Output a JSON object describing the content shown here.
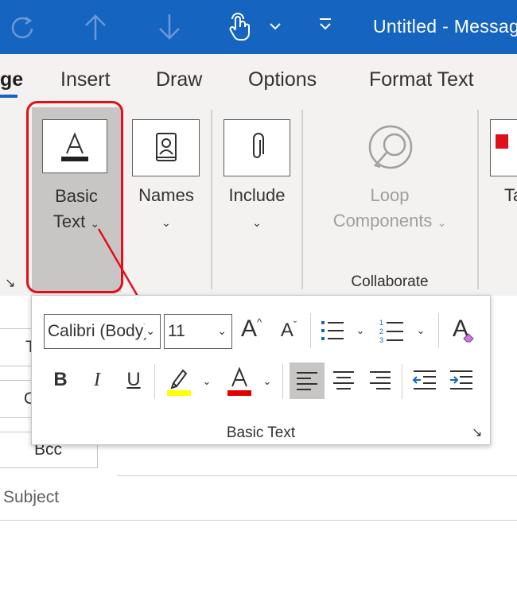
{
  "window": {
    "title": "Untitled  -  Message"
  },
  "quick_access": [
    {
      "name": "redo-icon"
    },
    {
      "name": "up-arrow-icon"
    },
    {
      "name": "down-arrow-icon"
    },
    {
      "name": "touch-mode-icon"
    },
    {
      "name": "customize-toolbar-icon"
    }
  ],
  "tabs": [
    {
      "label": "Message",
      "visible": "ge",
      "selected": true
    },
    {
      "label": "Insert"
    },
    {
      "label": "Draw"
    },
    {
      "label": "Options"
    },
    {
      "label": "Format Text"
    }
  ],
  "ribbon": {
    "basic_text": {
      "line1": "Basic",
      "line2": "Text",
      "chev": "⌄",
      "icon": "font-color-icon"
    },
    "names": {
      "line1": "Names",
      "chev": "⌄",
      "icon": "address-book-icon"
    },
    "include": {
      "line1": "Include",
      "chev": "⌄",
      "icon": "paperclip-icon"
    },
    "loop": {
      "line1": "Loop",
      "line2": "Components",
      "chev": "⌄",
      "icon": "loop-icon",
      "enabled": false
    },
    "next_partial": {
      "label": "Ta"
    },
    "groups": [
      {
        "label": "Collaborate"
      }
    ],
    "dialog_launcher": "↘"
  },
  "compose": {
    "to_label": "T",
    "cc_label": "C",
    "bcc_label": "Bcc",
    "subject_placeholder": "Subject"
  },
  "popup": {
    "font_name": "Calibri (Body)",
    "font_size": "11",
    "group_label": "Basic Text",
    "launcher": "↘",
    "bold": "B",
    "italic": "I",
    "underline": "U",
    "grow": "A",
    "shrink": "A",
    "clear": "A",
    "font_color": "A",
    "highlight_color": "#ffff00",
    "text_color": "#e00000",
    "chev": "⌄",
    "bullets": [
      "1",
      "2",
      "3"
    ]
  },
  "colors": {
    "accent": "#1565c0",
    "highlight": "#e0101a"
  }
}
